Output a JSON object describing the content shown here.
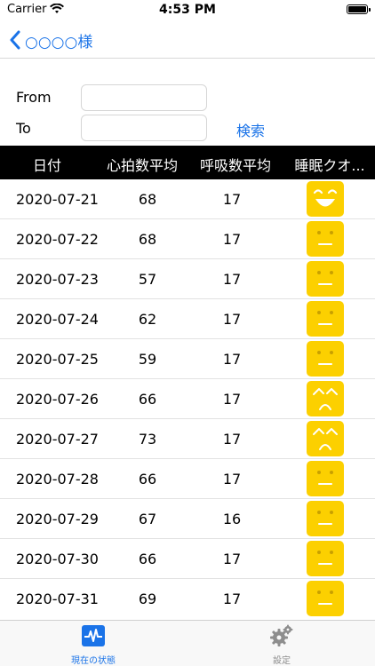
{
  "status_bar": {
    "carrier": "Carrier",
    "time": "4:53 PM"
  },
  "nav": {
    "back_label": "○○○○様"
  },
  "filter": {
    "from_label": "From",
    "from_value": "",
    "to_label": "To",
    "to_value": "",
    "search_label": "検索"
  },
  "table": {
    "headers": {
      "date": "日付",
      "heart_rate": "心拍数平均",
      "respiration": "呼吸数平均",
      "sleep_quality": "睡眠クオ..."
    },
    "rows": [
      {
        "date": "2020-07-21",
        "heart_rate": "68",
        "respiration": "17",
        "face": "happy"
      },
      {
        "date": "2020-07-22",
        "heart_rate": "68",
        "respiration": "17",
        "face": "neutral"
      },
      {
        "date": "2020-07-23",
        "heart_rate": "57",
        "respiration": "17",
        "face": "neutral"
      },
      {
        "date": "2020-07-24",
        "heart_rate": "62",
        "respiration": "17",
        "face": "neutral"
      },
      {
        "date": "2020-07-25",
        "heart_rate": "59",
        "respiration": "17",
        "face": "neutral"
      },
      {
        "date": "2020-07-26",
        "heart_rate": "66",
        "respiration": "17",
        "face": "sad"
      },
      {
        "date": "2020-07-27",
        "heart_rate": "73",
        "respiration": "17",
        "face": "sad"
      },
      {
        "date": "2020-07-28",
        "heart_rate": "66",
        "respiration": "17",
        "face": "neutral"
      },
      {
        "date": "2020-07-29",
        "heart_rate": "67",
        "respiration": "16",
        "face": "neutral"
      },
      {
        "date": "2020-07-30",
        "heart_rate": "66",
        "respiration": "17",
        "face": "neutral"
      },
      {
        "date": "2020-07-31",
        "heart_rate": "69",
        "respiration": "17",
        "face": "neutral"
      }
    ]
  },
  "tabs": [
    {
      "label": "現在の状態",
      "icon": "heart-monitor-icon",
      "active": true
    },
    {
      "label": "設定",
      "icon": "gear-icon",
      "active": false
    }
  ],
  "colors": {
    "accent": "#1a73e8",
    "face_bg": "#fcd000",
    "header_bg": "#000000"
  }
}
